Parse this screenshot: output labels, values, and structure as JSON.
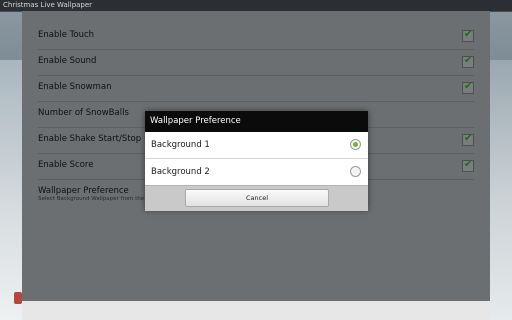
{
  "window": {
    "title": "Christmas Live Wallpaper"
  },
  "settings": {
    "enable_touch": {
      "label": "Enable Touch",
      "checked": true
    },
    "enable_sound": {
      "label": "Enable Sound",
      "checked": true
    },
    "enable_snowman": {
      "label": "Enable Snowman",
      "checked": true
    },
    "number_of_snowballs": {
      "label": "Number of SnowBalls"
    },
    "enable_shake": {
      "label": "Enable Shake Start/Stop",
      "checked": true
    },
    "enable_score": {
      "label": "Enable Score",
      "checked": true
    },
    "wallpaper_preference": {
      "label": "Wallpaper Preference",
      "summary": "Select Background Wallpaper from the list"
    }
  },
  "dialog": {
    "title": "Wallpaper Preference",
    "options": [
      {
        "label": "Background 1",
        "selected": true
      },
      {
        "label": "Background 2",
        "selected": false
      }
    ],
    "cancel_label": "Cancel"
  },
  "colors": {
    "accent": "#7ab03c",
    "check": "#1c6b1c",
    "dialog_title_bg": "#0b0b0b"
  },
  "icons": {
    "checkbox": "checkmark-icon",
    "radio_on": "radio-checked-icon",
    "radio_off": "radio-unchecked-icon"
  }
}
